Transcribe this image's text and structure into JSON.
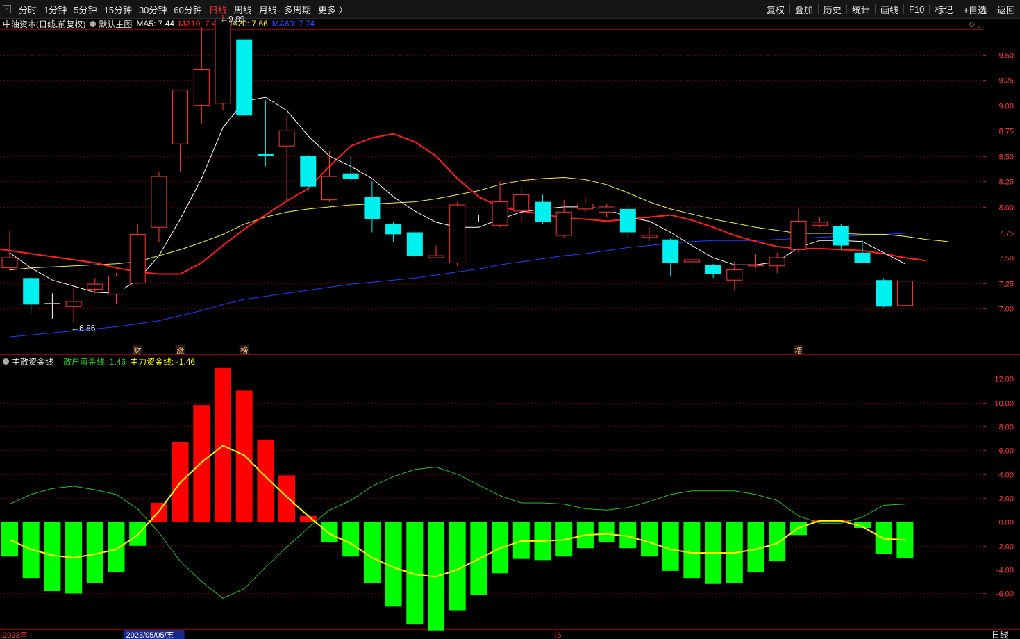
{
  "toolbar": {
    "periods": [
      "分时",
      "1分钟",
      "5分钟",
      "15分钟",
      "30分钟",
      "60分钟",
      "日线",
      "周线",
      "月线",
      "多周期",
      "更多 〉"
    ],
    "active_period": "日线",
    "right_buttons": [
      "复权",
      "叠加",
      "历史",
      "统计",
      "画线",
      "F10",
      "标记",
      "+自选",
      "返回"
    ]
  },
  "main_header": {
    "stock": "中油资本(日线,前复权)",
    "template": "默认主图",
    "ma5": "MA5: 7.44",
    "ma10": "MA10: 7.47",
    "ma20": "MA20: 7.66",
    "ma60": "MA60: 7.74"
  },
  "sub_header": {
    "title": "主散资金线",
    "retail": "散户资金线: 1.46",
    "main": "主力资金线: -1.46"
  },
  "colors": {
    "up": "#ff3b3b",
    "down": "#00f0f0",
    "ma5": "#ffffff",
    "ma10": "#ff2020",
    "ma20": "#f0f050",
    "ma60": "#2040ff",
    "bar_pos": "#ff0000",
    "bar_neg": "#00ff00",
    "line_main": "#ffff00",
    "line_retail": "#30c030"
  },
  "chart_data": [
    {
      "type": "candlestick",
      "y_ticks": [
        "9.50",
        "9.25",
        "9.00",
        "8.75",
        "8.50",
        "8.25",
        "8.00",
        "7.75",
        "7.50",
        "7.25",
        "7.00"
      ],
      "ylim": [
        6.55,
        9.75
      ],
      "candles": [
        [
          7.4,
          7.5,
          7.76,
          7.37
        ],
        [
          7.3,
          7.04,
          7.32,
          6.95
        ],
        [
          7.05,
          7.05,
          7.15,
          6.9
        ],
        [
          7.02,
          7.07,
          7.2,
          6.86
        ],
        [
          7.19,
          7.24,
          7.3,
          7.15
        ],
        [
          7.14,
          7.32,
          7.35,
          7.05
        ],
        [
          7.25,
          7.73,
          7.83,
          7.24
        ],
        [
          7.8,
          8.3,
          8.35,
          7.65
        ],
        [
          8.62,
          9.15,
          9.15,
          8.35
        ],
        [
          9.0,
          9.35,
          9.77,
          8.82
        ],
        [
          9.02,
          9.85,
          9.89,
          8.95
        ],
        [
          9.65,
          8.9,
          9.65,
          8.88
        ],
        [
          8.52,
          8.5,
          9.05,
          8.4
        ],
        [
          8.6,
          8.75,
          8.9,
          8.05
        ],
        [
          8.5,
          8.2,
          8.52,
          8.15
        ],
        [
          8.07,
          8.3,
          8.55,
          8.05
        ],
        [
          8.33,
          8.28,
          8.5,
          8.25
        ],
        [
          8.1,
          7.88,
          8.25,
          7.75
        ],
        [
          7.83,
          7.73,
          7.85,
          7.65
        ],
        [
          7.75,
          7.52,
          7.77,
          7.5
        ],
        [
          7.5,
          7.52,
          7.62,
          7.5
        ],
        [
          7.45,
          8.02,
          8.05,
          7.42
        ],
        [
          7.88,
          7.88,
          7.92,
          7.85
        ],
        [
          7.82,
          8.05,
          8.25,
          7.8
        ],
        [
          7.96,
          8.12,
          8.18,
          7.85
        ],
        [
          8.05,
          7.85,
          8.12,
          7.83
        ],
        [
          7.72,
          7.95,
          8.07,
          7.7
        ],
        [
          7.98,
          8.03,
          8.1,
          7.95
        ],
        [
          7.95,
          8.0,
          8.03,
          7.9
        ],
        [
          7.98,
          7.75,
          8.02,
          7.7
        ],
        [
          7.7,
          7.72,
          7.8,
          7.66
        ],
        [
          7.68,
          7.45,
          7.69,
          7.32
        ],
        [
          7.46,
          7.48,
          7.56,
          7.38
        ],
        [
          7.43,
          7.34,
          7.44,
          7.3
        ],
        [
          7.28,
          7.38,
          7.46,
          7.18
        ],
        [
          7.42,
          7.43,
          7.54,
          7.4
        ],
        [
          7.42,
          7.5,
          7.55,
          7.35
        ],
        [
          7.58,
          7.86,
          7.98,
          7.55
        ],
        [
          7.82,
          7.85,
          7.9,
          7.8
        ],
        [
          7.81,
          7.62,
          7.83,
          7.58
        ],
        [
          7.55,
          7.45,
          7.68,
          7.45
        ],
        [
          7.28,
          7.02,
          7.3,
          7.01
        ],
        [
          7.03,
          7.27,
          7.3,
          7.01
        ]
      ],
      "ma5": [
        7.55,
        7.4,
        7.28,
        7.22,
        7.16,
        7.15,
        7.28,
        7.52,
        7.88,
        8.28,
        8.78,
        9.04,
        9.08,
        8.95,
        8.7,
        8.5,
        8.4,
        8.28,
        8.1,
        7.96,
        7.85,
        7.8,
        7.8,
        7.88,
        7.95,
        7.98,
        8.0,
        8.0,
        7.98,
        7.9,
        7.86,
        7.75,
        7.62,
        7.5,
        7.43,
        7.43,
        7.46,
        7.6,
        7.67,
        7.67,
        7.66,
        7.55,
        7.44
      ],
      "ma10": [
        7.6,
        7.57,
        7.54,
        7.51,
        7.48,
        7.45,
        7.4,
        7.36,
        7.34,
        7.34,
        7.45,
        7.62,
        7.78,
        7.92,
        8.06,
        8.18,
        8.4,
        8.6,
        8.68,
        8.72,
        8.64,
        8.5,
        8.28,
        8.1,
        8.0,
        7.96,
        7.93,
        7.89,
        7.88,
        7.86,
        7.88,
        7.9,
        7.92,
        7.87,
        7.8,
        7.72,
        7.66,
        7.61,
        7.59,
        7.59,
        7.58,
        7.57,
        7.54,
        7.5,
        7.47
      ],
      "ma20": [
        7.38,
        7.4,
        7.41,
        7.42,
        7.43,
        7.44,
        7.46,
        7.52,
        7.58,
        7.65,
        7.73,
        7.83,
        7.9,
        7.95,
        7.98,
        8.0,
        8.02,
        8.03,
        8.04,
        8.05,
        8.08,
        8.12,
        8.16,
        8.22,
        8.26,
        8.28,
        8.29,
        8.27,
        8.22,
        8.14,
        8.05,
        7.98,
        7.93,
        7.88,
        7.84,
        7.8,
        7.77,
        7.74,
        7.74,
        7.74,
        7.73,
        7.73,
        7.71,
        7.68,
        7.66
      ],
      "ma60": [
        6.72,
        6.74,
        6.76,
        6.78,
        6.8,
        6.82,
        6.85,
        6.88,
        6.93,
        6.98,
        7.04,
        7.09,
        7.12,
        7.15,
        7.18,
        7.21,
        7.24,
        7.26,
        7.28,
        7.3,
        7.33,
        7.36,
        7.39,
        7.43,
        7.46,
        7.49,
        7.52,
        7.54,
        7.57,
        7.6,
        7.62,
        7.64,
        7.66,
        7.67,
        7.67,
        7.67,
        7.68,
        7.69,
        7.7,
        7.71,
        7.72,
        7.73,
        7.74
      ],
      "annotations": {
        "high": "9.89",
        "low": "6.86"
      },
      "event_markers": [
        {
          "index": 6,
          "label": "财"
        },
        {
          "index": 8,
          "label": "涨"
        },
        {
          "index": 11,
          "label": "榜"
        },
        {
          "index": 37,
          "label": "增"
        }
      ]
    },
    {
      "type": "bar",
      "y_ticks": [
        "12.00",
        "10.00",
        "8.00",
        "6.00",
        "4.00",
        "2.00",
        "0.00",
        "-2.00",
        "-4.00",
        "-6.00"
      ],
      "ylim": [
        -9.0,
        14.0
      ],
      "values": [
        -2.9,
        -4.7,
        -5.8,
        -6.0,
        -5.1,
        -4.2,
        -2.0,
        1.6,
        6.7,
        9.8,
        12.9,
        11.0,
        6.9,
        3.9,
        0.5,
        -1.7,
        -2.9,
        -5.1,
        -7.1,
        -8.6,
        -9.1,
        -7.4,
        -6.1,
        -4.3,
        -3.1,
        -3.2,
        -2.9,
        -2.2,
        -1.7,
        -2.2,
        -2.9,
        -4.1,
        -4.7,
        -5.2,
        -5.1,
        -4.2,
        -3.3,
        -1.1,
        0.2,
        0.2,
        -0.5,
        -2.7,
        -3.0
      ],
      "main_line": [
        -1.5,
        -2.3,
        -2.8,
        -3.0,
        -2.7,
        -2.3,
        -1.1,
        0.9,
        3.3,
        5.0,
        6.4,
        5.6,
        3.8,
        2.1,
        0.5,
        -1.0,
        -1.8,
        -3.0,
        -3.8,
        -4.4,
        -4.6,
        -4.0,
        -3.1,
        -2.2,
        -1.6,
        -1.6,
        -1.5,
        -1.1,
        -1.0,
        -1.2,
        -1.7,
        -2.3,
        -2.6,
        -2.6,
        -2.6,
        -2.3,
        -1.8,
        -0.5,
        0.1,
        0.1,
        -0.4,
        -1.4,
        -1.5
      ],
      "retail_line": [
        1.5,
        2.3,
        2.8,
        3.0,
        2.7,
        2.3,
        1.1,
        -0.9,
        -3.3,
        -5.0,
        -6.4,
        -5.6,
        -3.8,
        -2.1,
        -0.5,
        1.0,
        1.8,
        3.0,
        3.8,
        4.4,
        4.6,
        4.0,
        3.1,
        2.2,
        1.6,
        1.6,
        1.5,
        1.1,
        1.0,
        1.2,
        1.7,
        2.3,
        2.6,
        2.6,
        2.6,
        2.3,
        1.8,
        0.5,
        -0.1,
        -0.1,
        0.4,
        1.4,
        1.5
      ]
    }
  ],
  "x_axis": {
    "labels": [
      {
        "index": 0,
        "text": "2023年"
      },
      {
        "index": 6,
        "text": "5"
      },
      {
        "index": 8,
        "text": "2023/05/05/五"
      },
      {
        "index": 26,
        "text": "6"
      }
    ],
    "corner": "日线"
  }
}
